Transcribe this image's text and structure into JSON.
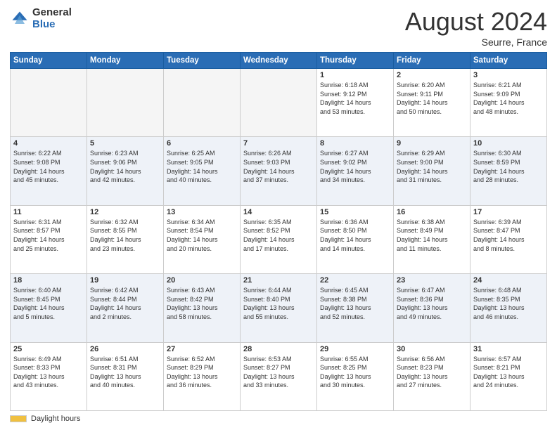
{
  "header": {
    "logo_general": "General",
    "logo_blue": "Blue",
    "title": "August 2024",
    "location": "Seurre, France"
  },
  "footer": {
    "legend_label": "Daylight hours"
  },
  "days_of_week": [
    "Sunday",
    "Monday",
    "Tuesday",
    "Wednesday",
    "Thursday",
    "Friday",
    "Saturday"
  ],
  "weeks": [
    [
      {
        "num": "",
        "info": ""
      },
      {
        "num": "",
        "info": ""
      },
      {
        "num": "",
        "info": ""
      },
      {
        "num": "",
        "info": ""
      },
      {
        "num": "1",
        "info": "Sunrise: 6:18 AM\nSunset: 9:12 PM\nDaylight: 14 hours\nand 53 minutes."
      },
      {
        "num": "2",
        "info": "Sunrise: 6:20 AM\nSunset: 9:11 PM\nDaylight: 14 hours\nand 50 minutes."
      },
      {
        "num": "3",
        "info": "Sunrise: 6:21 AM\nSunset: 9:09 PM\nDaylight: 14 hours\nand 48 minutes."
      }
    ],
    [
      {
        "num": "4",
        "info": "Sunrise: 6:22 AM\nSunset: 9:08 PM\nDaylight: 14 hours\nand 45 minutes."
      },
      {
        "num": "5",
        "info": "Sunrise: 6:23 AM\nSunset: 9:06 PM\nDaylight: 14 hours\nand 42 minutes."
      },
      {
        "num": "6",
        "info": "Sunrise: 6:25 AM\nSunset: 9:05 PM\nDaylight: 14 hours\nand 40 minutes."
      },
      {
        "num": "7",
        "info": "Sunrise: 6:26 AM\nSunset: 9:03 PM\nDaylight: 14 hours\nand 37 minutes."
      },
      {
        "num": "8",
        "info": "Sunrise: 6:27 AM\nSunset: 9:02 PM\nDaylight: 14 hours\nand 34 minutes."
      },
      {
        "num": "9",
        "info": "Sunrise: 6:29 AM\nSunset: 9:00 PM\nDaylight: 14 hours\nand 31 minutes."
      },
      {
        "num": "10",
        "info": "Sunrise: 6:30 AM\nSunset: 8:59 PM\nDaylight: 14 hours\nand 28 minutes."
      }
    ],
    [
      {
        "num": "11",
        "info": "Sunrise: 6:31 AM\nSunset: 8:57 PM\nDaylight: 14 hours\nand 25 minutes."
      },
      {
        "num": "12",
        "info": "Sunrise: 6:32 AM\nSunset: 8:55 PM\nDaylight: 14 hours\nand 23 minutes."
      },
      {
        "num": "13",
        "info": "Sunrise: 6:34 AM\nSunset: 8:54 PM\nDaylight: 14 hours\nand 20 minutes."
      },
      {
        "num": "14",
        "info": "Sunrise: 6:35 AM\nSunset: 8:52 PM\nDaylight: 14 hours\nand 17 minutes."
      },
      {
        "num": "15",
        "info": "Sunrise: 6:36 AM\nSunset: 8:50 PM\nDaylight: 14 hours\nand 14 minutes."
      },
      {
        "num": "16",
        "info": "Sunrise: 6:38 AM\nSunset: 8:49 PM\nDaylight: 14 hours\nand 11 minutes."
      },
      {
        "num": "17",
        "info": "Sunrise: 6:39 AM\nSunset: 8:47 PM\nDaylight: 14 hours\nand 8 minutes."
      }
    ],
    [
      {
        "num": "18",
        "info": "Sunrise: 6:40 AM\nSunset: 8:45 PM\nDaylight: 14 hours\nand 5 minutes."
      },
      {
        "num": "19",
        "info": "Sunrise: 6:42 AM\nSunset: 8:44 PM\nDaylight: 14 hours\nand 2 minutes."
      },
      {
        "num": "20",
        "info": "Sunrise: 6:43 AM\nSunset: 8:42 PM\nDaylight: 13 hours\nand 58 minutes."
      },
      {
        "num": "21",
        "info": "Sunrise: 6:44 AM\nSunset: 8:40 PM\nDaylight: 13 hours\nand 55 minutes."
      },
      {
        "num": "22",
        "info": "Sunrise: 6:45 AM\nSunset: 8:38 PM\nDaylight: 13 hours\nand 52 minutes."
      },
      {
        "num": "23",
        "info": "Sunrise: 6:47 AM\nSunset: 8:36 PM\nDaylight: 13 hours\nand 49 minutes."
      },
      {
        "num": "24",
        "info": "Sunrise: 6:48 AM\nSunset: 8:35 PM\nDaylight: 13 hours\nand 46 minutes."
      }
    ],
    [
      {
        "num": "25",
        "info": "Sunrise: 6:49 AM\nSunset: 8:33 PM\nDaylight: 13 hours\nand 43 minutes."
      },
      {
        "num": "26",
        "info": "Sunrise: 6:51 AM\nSunset: 8:31 PM\nDaylight: 13 hours\nand 40 minutes."
      },
      {
        "num": "27",
        "info": "Sunrise: 6:52 AM\nSunset: 8:29 PM\nDaylight: 13 hours\nand 36 minutes."
      },
      {
        "num": "28",
        "info": "Sunrise: 6:53 AM\nSunset: 8:27 PM\nDaylight: 13 hours\nand 33 minutes."
      },
      {
        "num": "29",
        "info": "Sunrise: 6:55 AM\nSunset: 8:25 PM\nDaylight: 13 hours\nand 30 minutes."
      },
      {
        "num": "30",
        "info": "Sunrise: 6:56 AM\nSunset: 8:23 PM\nDaylight: 13 hours\nand 27 minutes."
      },
      {
        "num": "31",
        "info": "Sunrise: 6:57 AM\nSunset: 8:21 PM\nDaylight: 13 hours\nand 24 minutes."
      }
    ]
  ]
}
